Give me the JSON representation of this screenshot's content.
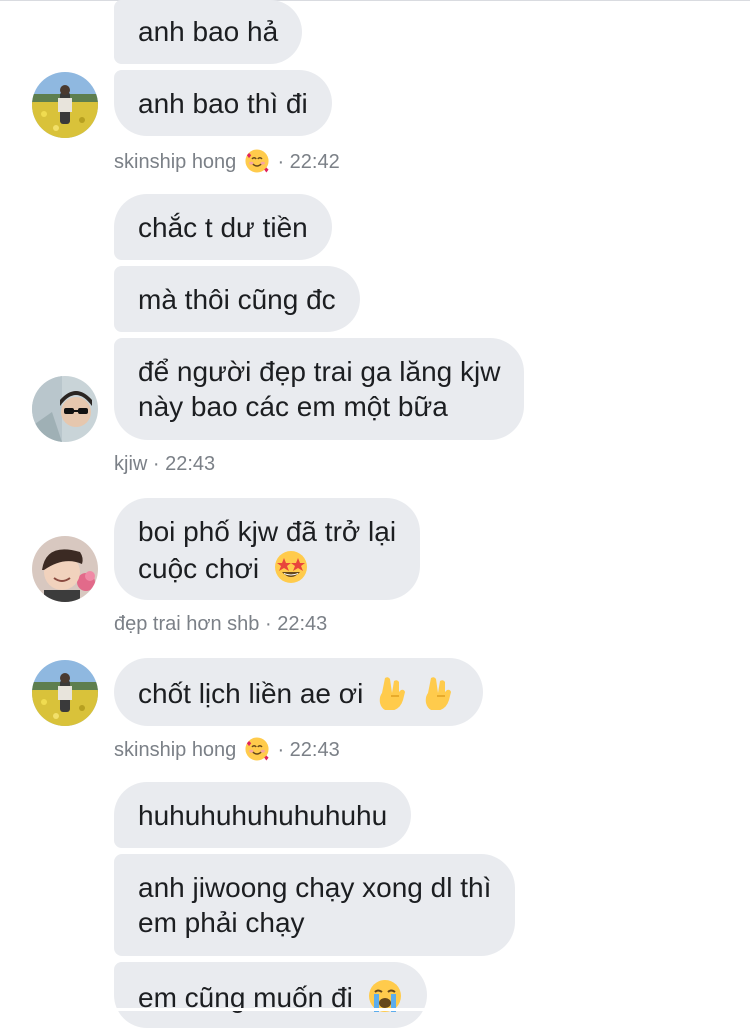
{
  "messages": [
    {
      "text": "anh bao hả"
    },
    {
      "text": "anh bao thì đi"
    },
    {
      "text": "chắc t dư tiền"
    },
    {
      "text": "mà thôi cũng đc"
    },
    {
      "line1": "để người đẹp trai ga lăng kjw",
      "line2": "này bao các em một bữa"
    },
    {
      "line1": "boi phố kjw đã trở lại",
      "line2": "cuộc chơi"
    },
    {
      "text": "chốt lịch liền ae ơi"
    },
    {
      "text": "huhuhuhuhuhuhuhu"
    },
    {
      "line1": "anh jiwoong chạy xong dl thì",
      "line2": "em phải chạy"
    },
    {
      "text": "em cũng muốn đi"
    }
  ],
  "meta": [
    {
      "name": "skinship hong",
      "time": "· 22:42",
      "emoji": "smiling-face-with-hearts"
    },
    {
      "name": "kjiw",
      "time": "· 22:43"
    },
    {
      "name": "đẹp trai hơn shb",
      "time": "· 22:43"
    },
    {
      "name": "skinship hong",
      "time": "· 22:43",
      "emoji": "smiling-face-with-hearts"
    }
  ],
  "emojis": {
    "star_struck": "star-struck-emoji",
    "rock_hand": "sign-of-the-horns-emoji",
    "crying": "loudly-crying-face-emoji"
  },
  "colors": {
    "bubble_bg": "#e9ebef",
    "text": "#1c1e21",
    "meta_text": "#7b8087"
  }
}
